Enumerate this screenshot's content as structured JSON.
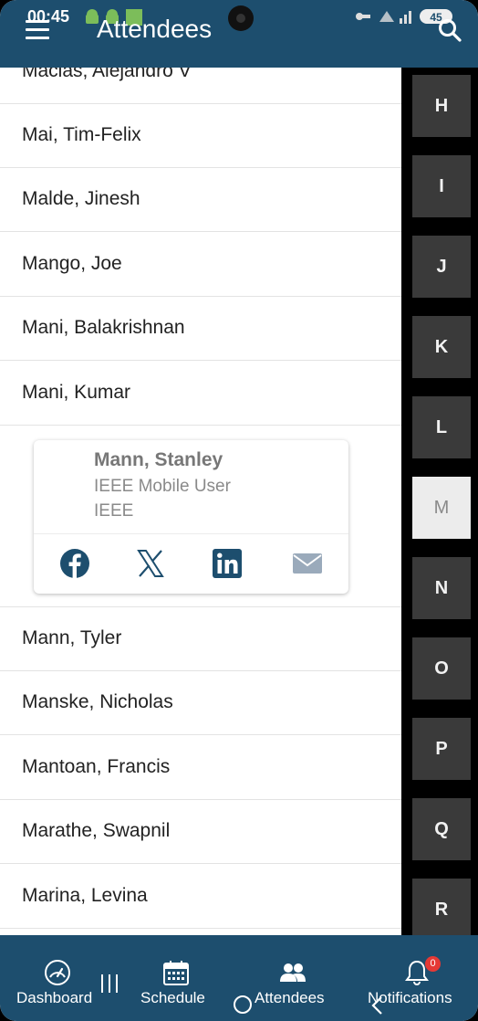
{
  "status_bar": {
    "time": "00:45",
    "battery": "45"
  },
  "header": {
    "title": "Attendees"
  },
  "attendees": [
    "Macias, Alejandro V",
    "Mai, Tim-Felix",
    "Malde, Jinesh",
    "Mango, Joe",
    "Mani, Balakrishnan",
    "Mani, Kumar",
    "Mann, Tyler",
    "Manske, Nicholas",
    "Mantoan, Francis",
    "Marathe, Swapnil",
    "Marina, Levina"
  ],
  "expanded_card": {
    "name": "Mann, Stanley",
    "title": "IEEE Mobile User",
    "organization": "IEEE",
    "social_icons": [
      "facebook-icon",
      "x-icon",
      "linkedin-icon",
      "mail-icon"
    ]
  },
  "alphabet_index": {
    "letters": [
      "H",
      "I",
      "J",
      "K",
      "L",
      "M",
      "N",
      "O",
      "P",
      "Q",
      "R"
    ],
    "active": "M"
  },
  "bottom_nav": {
    "items": [
      {
        "label": "Dashboard",
        "icon": "gauge-icon"
      },
      {
        "label": "Schedule",
        "icon": "calendar-icon"
      },
      {
        "label": "Attendees",
        "icon": "people-icon"
      },
      {
        "label": "Notifications",
        "icon": "bell-icon"
      }
    ],
    "notification_count": "0"
  },
  "colors": {
    "primary": "#1d4e6e",
    "index_tile": "#3a3a3a",
    "index_active": "#ececec",
    "badge": "#e53935",
    "facebook": "#1d4e6e",
    "linkedin": "#1d4e6e",
    "mail": "#9aaabb"
  }
}
